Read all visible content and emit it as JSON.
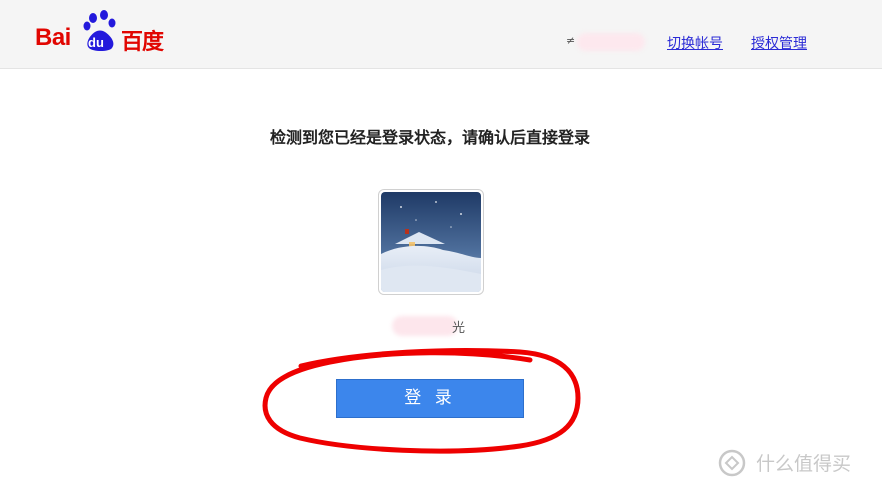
{
  "header": {
    "logo": {
      "latin": "Bai",
      "badge": "du",
      "chinese": "百度"
    },
    "user_marker": "≠",
    "links": {
      "switch_account": "切换帐号",
      "manage_authorization": "授权管理"
    }
  },
  "main": {
    "notice": "检测到您已经是登录状态，请确认后直接登录",
    "username_tail": "光",
    "login_button": "登 录"
  },
  "watermark": {
    "text": "什么值得买"
  },
  "colors": {
    "brand_red": "#e10601",
    "brand_blue": "#2319dc",
    "button_blue": "#3c86ec",
    "link_blue": "#2b2bd6",
    "annotation_red": "#ee0000"
  }
}
